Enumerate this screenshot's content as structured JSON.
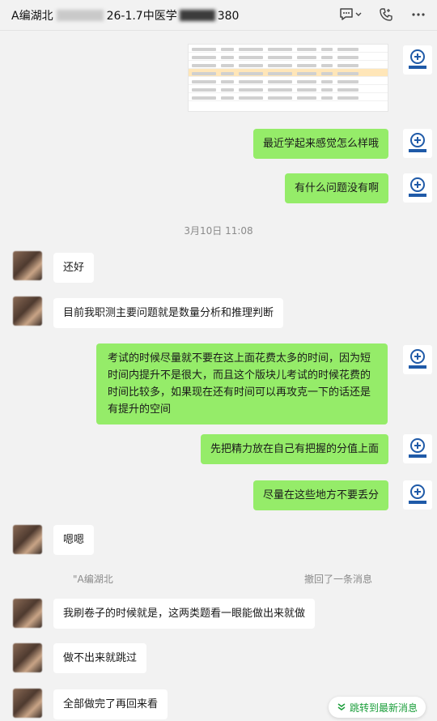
{
  "header": {
    "title_prefix": "A编湖北",
    "title_suffix": "26-1.7中医学",
    "title_end": "380",
    "icons": [
      "chat-bubble-icon",
      "chevron-down-icon",
      "phone-icon",
      "more-icon"
    ]
  },
  "time_separator": "3月10日 11:08",
  "messages_before": [
    {
      "text": "最近学起来感觉怎么样哦"
    },
    {
      "text": "有什么问题没有啊"
    }
  ],
  "messages_after": [
    {
      "text": "还好"
    },
    {
      "text": "目前我职测主要问题就是数量分析和推理判断"
    },
    {
      "text": "考试的时候尽量就不要在这上面花费太多的时间，因为短时间内提升不是很大，而且这个版块儿考试的时候花费的时间比较多，如果现在还有时间可以再攻克一下的话还是有提升的空间"
    },
    {
      "text": "先把精力放在自己有把握的分值上面"
    },
    {
      "text": "尽量在这些地方不要丢分"
    },
    {
      "text": "嗯嗯"
    }
  ],
  "recall": {
    "name": "\"A编湖北",
    "text": "撤回了一条消息"
  },
  "messages_final": [
    {
      "text": "我刷卷子的时候就是，这两类题看一眼能做出来就做"
    },
    {
      "text": "做不出来就跳过"
    },
    {
      "text": "全部做完了再回来看"
    }
  ],
  "jump_button": "跳转到最新消息",
  "colors": {
    "self_bubble": "#95ec69",
    "other_bubble": "#ffffff",
    "background": "#f2f2f2",
    "accent": "#1a9e3a",
    "logo_blue": "#1f5aa8"
  }
}
